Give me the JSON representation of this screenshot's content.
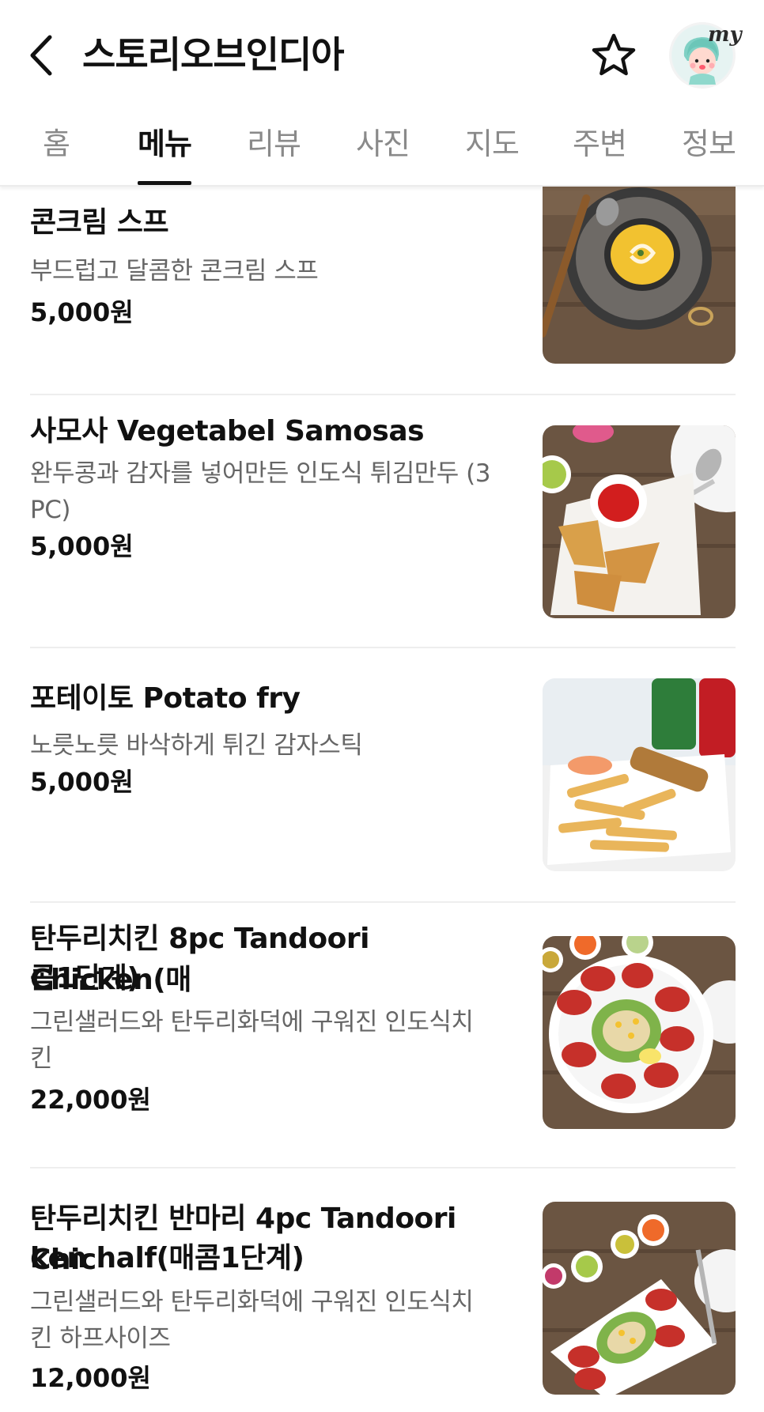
{
  "header": {
    "title": "스토리오브인디아",
    "avatar_badge": "my"
  },
  "tabs": [
    {
      "label": "홈",
      "active": false
    },
    {
      "label": "메뉴",
      "active": true
    },
    {
      "label": "리뷰",
      "active": false
    },
    {
      "label": "사진",
      "active": false
    },
    {
      "label": "지도",
      "active": false
    },
    {
      "label": "주변",
      "active": false
    },
    {
      "label": "정보",
      "active": false
    }
  ],
  "menu": [
    {
      "name": "콘크림 스프",
      "description": "부드럽고 달콤한 콘크림 스프",
      "price": "5,000원",
      "image": "corn-soup-photo"
    },
    {
      "name": "사모사 Vegetabel Samosas",
      "description_line1": "완두콩과 감자를 넣어만든 인도식 튀김만두 (3",
      "description_line2": "PC)",
      "price": "5,000원",
      "image": "samosa-photo"
    },
    {
      "name": "포테이토 Potato fry",
      "description": "노릇노릇 바삭하게 튀긴 감자스틱",
      "price": "5,000원",
      "image": "potato-fry-photo"
    },
    {
      "name_line1": "탄두리치킨 8pc Tandoori Chicken(매",
      "name_line2": "콤1단계)",
      "description_line1": "그린샐러드와 탄두리화덕에 구워진 인도식치",
      "description_line2": "킨",
      "price": "22,000원",
      "image": "tandoori-chicken-photo"
    },
    {
      "name_line1": "탄두리치킨 반마리 4pc Tandoori Chic",
      "name_line2": "ken half(매콤1단계)",
      "description_line1": "그린샐러드와 탄두리화덕에 구워진 인도식치",
      "description_line2": "킨 하프사이즈",
      "price": "12,000원",
      "image": "tandoori-chicken-half-photo"
    }
  ],
  "colors": {
    "text_primary": "#111111",
    "text_secondary": "#666666",
    "tab_inactive": "#8a8a8a",
    "divider": "#eeeeee"
  }
}
